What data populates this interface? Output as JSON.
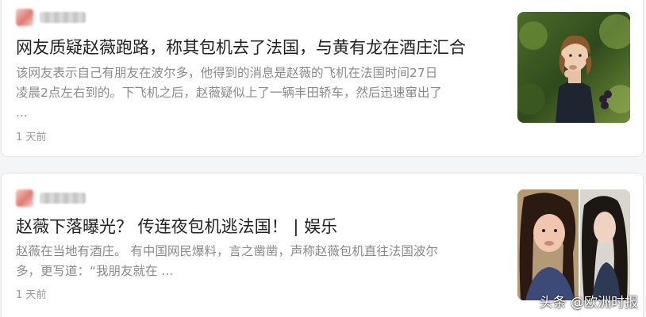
{
  "feed": {
    "items": [
      {
        "title": "网友质疑赵薇跑路，称其包机去了法国，与黄有龙在酒庄汇合",
        "abstract_lines": [
          "该网友表示自己有朋友在波尔多，他得到的消息是赵薇的飞机在法国时间27日",
          "凌晨2点左右到的。下飞机之后，赵薇疑似上了一辆丰田轿车，然后迅速窜出了",
          "..."
        ],
        "time": "1 天前"
      },
      {
        "title": "赵薇下落曝光？ 传连夜包机逃法国！ | 娱乐",
        "abstract_lines": [
          "赵薇在当地有酒庄。 有中国网民爆料，言之凿凿，声称赵薇包机直往法国波尔",
          "多，更写道：“我朋友就在 ..."
        ],
        "time": "1 天前"
      }
    ]
  },
  "watermark": "头条 @欧洲时报",
  "colors": {
    "title": "#222222",
    "abstract": "#8a8a8a",
    "time": "#999999",
    "card_border": "#e6e6e6",
    "background": "#f4f5f6"
  }
}
